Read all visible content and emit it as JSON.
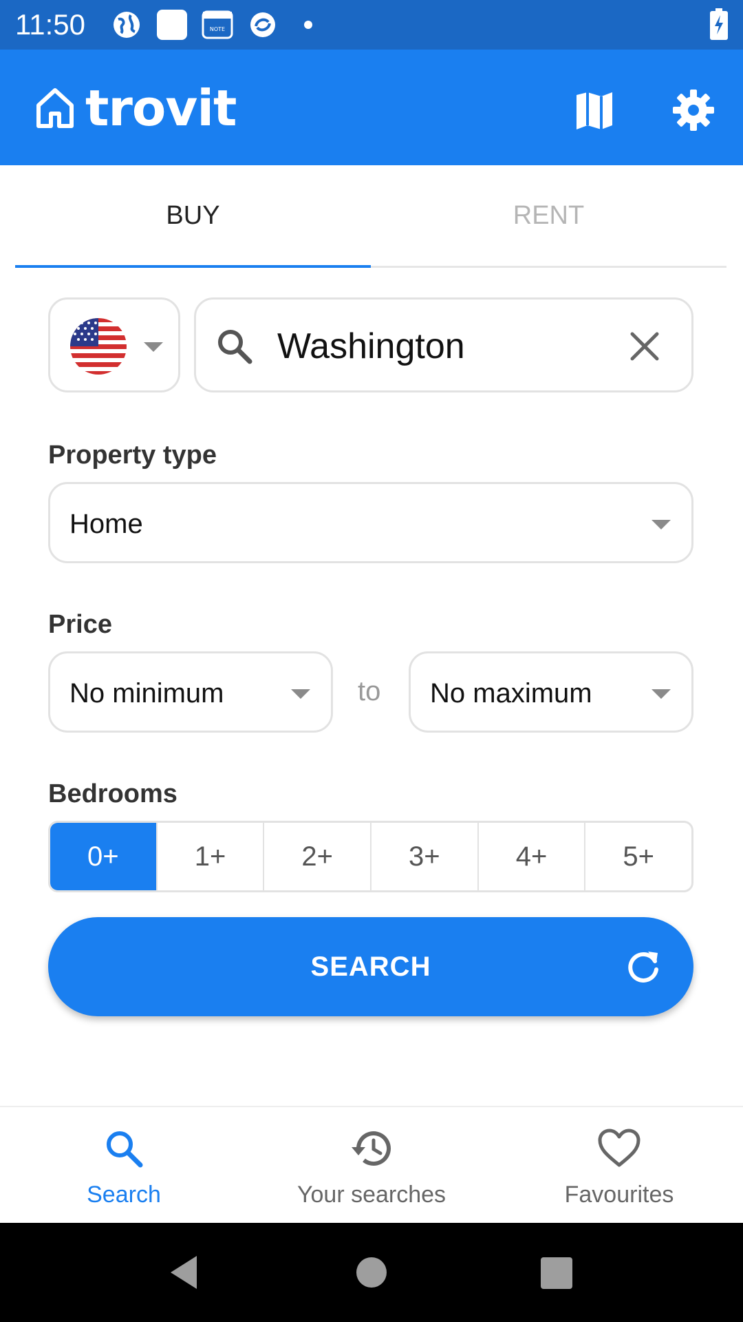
{
  "status_bar": {
    "time": "11:50"
  },
  "app": {
    "logo_text": "trovit",
    "brand_color": "#1a7ff0"
  },
  "tabs": [
    {
      "label": "BUY",
      "active": true
    },
    {
      "label": "RENT",
      "active": false
    }
  ],
  "location": {
    "country_icon": "us-flag-icon",
    "search_value": "Washington"
  },
  "property_type": {
    "label": "Property type",
    "value": "Home"
  },
  "price": {
    "label": "Price",
    "min": "No minimum",
    "separator": "to",
    "max": "No maximum"
  },
  "bedrooms": {
    "label": "Bedrooms",
    "options": [
      "0+",
      "1+",
      "2+",
      "3+",
      "4+",
      "5+"
    ],
    "selected": "0+"
  },
  "search_button": {
    "label": "SEARCH"
  },
  "bottom_nav": [
    {
      "label": "Search",
      "icon": "search-icon",
      "active": true
    },
    {
      "label": "Your searches",
      "icon": "history-icon",
      "active": false
    },
    {
      "label": "Favourites",
      "icon": "heart-icon",
      "active": false
    }
  ]
}
